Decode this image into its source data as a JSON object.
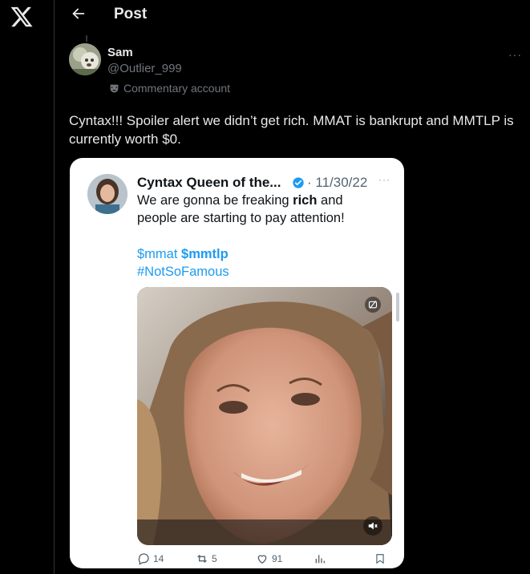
{
  "header": {
    "title": "Post"
  },
  "post": {
    "author_name": "Sam",
    "author_handle": "@Outlier_999",
    "account_label": "Commentary account",
    "more": "···",
    "text": "Cyntax!!! Spoiler alert we didn’t get rich. MMAT is bankrupt and MMTLP is currently worth $0."
  },
  "card": {
    "name": "Cyntax Queen of the...",
    "date": "· 11/30/22",
    "more": "···",
    "text_before": "We are gonna be freaking ",
    "text_bold": "rich",
    "text_after": " and people are starting to pay attention!",
    "tag1": "$mmat",
    "tag2": "$mmtlp",
    "tag3": "#NotSoFamous",
    "actions": {
      "replies": "14",
      "reposts": "5",
      "likes": "91"
    }
  },
  "colors": {
    "background": "#000000",
    "text_primary": "#e7e9ea",
    "text_secondary": "#71767b",
    "link": "#1d9bf0",
    "card_bg": "#ffffff"
  }
}
